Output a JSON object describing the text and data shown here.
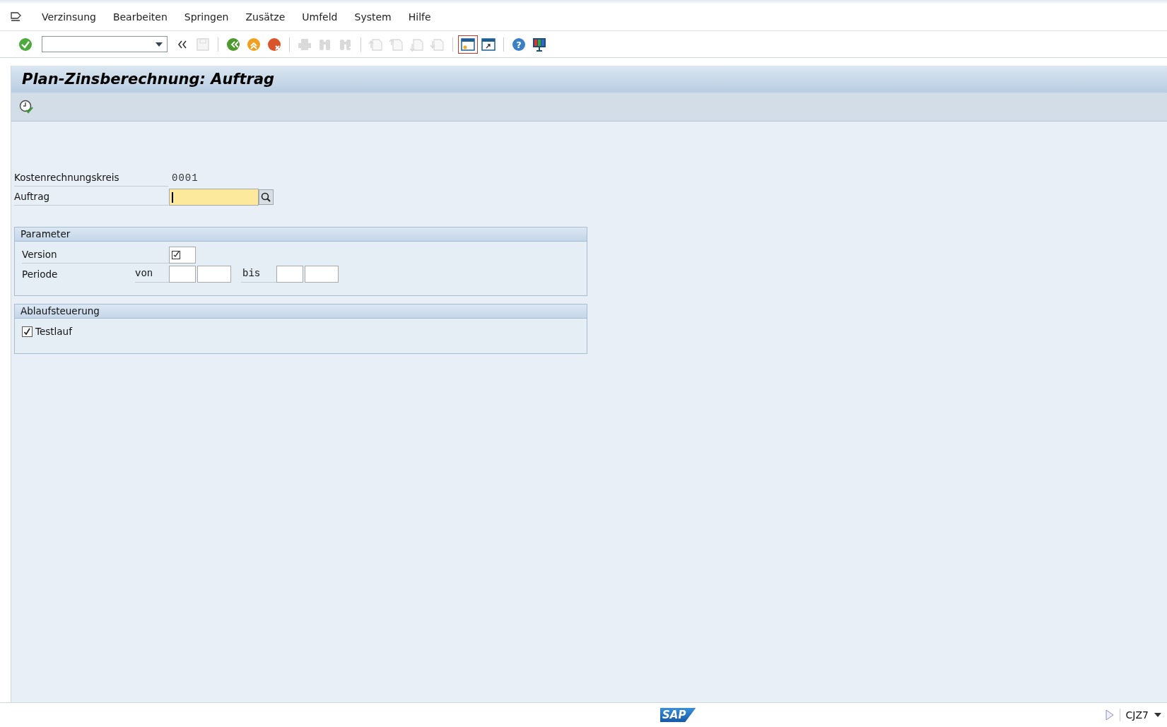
{
  "menu": [
    {
      "label": "Verzinsung"
    },
    {
      "label": "Bearbeiten"
    },
    {
      "label": "Springen"
    },
    {
      "label": "Zusätze"
    },
    {
      "label": "Umfeld"
    },
    {
      "label": "System"
    },
    {
      "label": "Hilfe"
    }
  ],
  "toolbar": [
    {
      "kind": "enter",
      "disabled": false
    },
    {
      "kind": "command"
    },
    {
      "kind": "collapse",
      "disabled": false
    },
    {
      "kind": "save",
      "disabled": true
    },
    {
      "kind": "sep"
    },
    {
      "kind": "back",
      "disabled": false
    },
    {
      "kind": "exit",
      "disabled": false
    },
    {
      "kind": "cancel",
      "disabled": false
    },
    {
      "kind": "sep"
    },
    {
      "kind": "print",
      "disabled": true
    },
    {
      "kind": "find",
      "disabled": true
    },
    {
      "kind": "findnext",
      "disabled": true
    },
    {
      "kind": "sep"
    },
    {
      "kind": "first",
      "disabled": true
    },
    {
      "kind": "prev",
      "disabled": true
    },
    {
      "kind": "next",
      "disabled": true
    },
    {
      "kind": "last",
      "disabled": true
    },
    {
      "kind": "sep"
    },
    {
      "kind": "newsession",
      "disabled": false,
      "selected": true
    },
    {
      "kind": "shortcut",
      "disabled": false,
      "selected": false
    },
    {
      "kind": "sep"
    },
    {
      "kind": "help",
      "disabled": false,
      "glyph": "?"
    },
    {
      "kind": "layout",
      "disabled": false
    }
  ],
  "title": "Plan-Zinsberechnung: Auftrag",
  "fields": [
    {
      "label": "Kostenrechnungskreis",
      "value": "0001",
      "kind": "display"
    },
    {
      "label": "Auftrag",
      "kind": "input",
      "focused": true
    }
  ],
  "parameter": {
    "title": "Parameter",
    "version": {
      "label": "Version",
      "checked": true
    },
    "periode": {
      "label": "Periode",
      "from_label": "von",
      "to_label": "bis"
    }
  },
  "ablauf": {
    "title": "Ablaufsteuerung",
    "testlauf": {
      "label": "Testlauf",
      "checked": true
    }
  },
  "status_bar": {
    "logo": "SAP",
    "transaction": "CJZ7"
  }
}
